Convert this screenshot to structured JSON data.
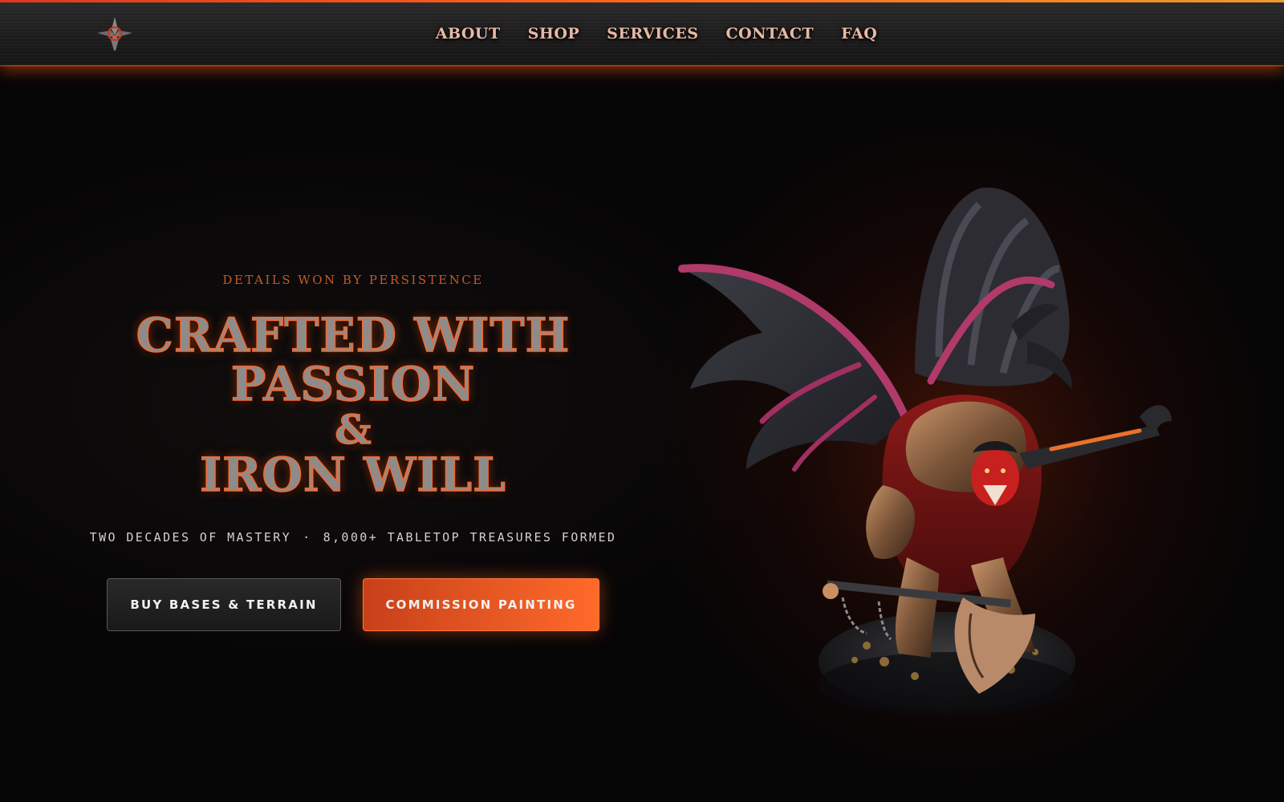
{
  "nav": {
    "logo_icon": "dagger-emblem-icon",
    "links": [
      {
        "label": "ABOUT"
      },
      {
        "label": "SHOP"
      },
      {
        "label": "SERVICES"
      },
      {
        "label": "CONTACT"
      },
      {
        "label": "FAQ"
      }
    ]
  },
  "hero": {
    "tagline": "DETAILS WON BY PERSISTENCE",
    "headline_line1": "CRAFTED WITH PASSION",
    "headline_line2": "&",
    "headline_line3": "IRON WILL",
    "stat1": "TWO DECADES OF MASTERY",
    "stat_separator": "·",
    "stat2": "8,000+ TABLETOP TREASURES FORMED",
    "buttons": {
      "secondary_label": "BUY BASES & TERRAIN",
      "primary_label": "COMMISSION PAINTING"
    },
    "figure_icon": "winged-demon-miniature-icon"
  },
  "colors": {
    "accent": "#ff6a2a",
    "accent_dark": "#c8401a",
    "nav_text": "#e8b8a4",
    "tagline": "#c8582a",
    "background": "#060506"
  }
}
